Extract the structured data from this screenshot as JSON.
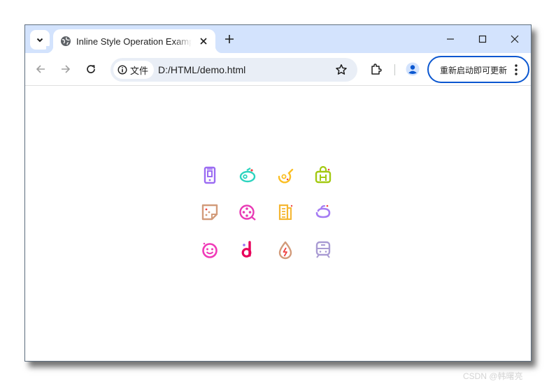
{
  "browser": {
    "tab": {
      "title": "Inline Style Operation Example"
    },
    "address_bar": {
      "security_chip_label": "文件",
      "url": "D:/HTML/demo.html"
    },
    "update_button": {
      "label": "重新启动即可更新"
    }
  },
  "colors": {
    "tab_strip": "#d3e3fd",
    "accent": "#0b57d0",
    "icons": [
      "#9b6cf2",
      "#2dd4bf",
      "#fbbf24",
      "#a3c911",
      "#d29b7a",
      "#e83ab5",
      "#f5b631",
      "#a57cf3",
      "#f03ab8",
      "#e8005a",
      "#d29b7a",
      "#a99bd3"
    ]
  },
  "icons": [
    "phone-icon",
    "cooking-pot-icon",
    "frying-pan-icon",
    "shopping-bag-icon",
    "sticky-note-icon",
    "film-reel-icon",
    "newspaper-icon",
    "tea-cup-icon",
    "smiley-face-icon",
    "bilibili-icon",
    "fire-drop-icon",
    "train-icon"
  ],
  "watermark": "CSDN @韩曙亮"
}
